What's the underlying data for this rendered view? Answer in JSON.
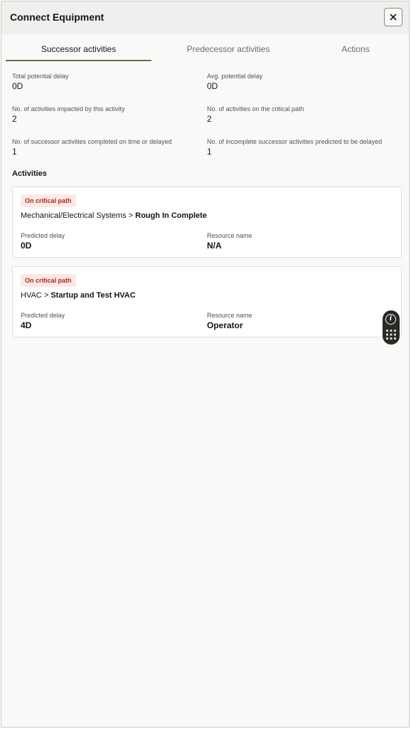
{
  "dialog": {
    "title": "Connect Equipment",
    "close_icon": "close-icon"
  },
  "tabs": [
    {
      "label": "Successor activities",
      "active": true
    },
    {
      "label": "Predecessor activities",
      "active": false
    },
    {
      "label": "Actions",
      "active": false
    }
  ],
  "metrics": {
    "total_potential_delay": {
      "label": "Total potential delay",
      "value": "0D"
    },
    "avg_potential_delay": {
      "label": "Avg. potential delay",
      "value": "0D"
    },
    "activities_impacted": {
      "label": "No. of activities impacted by this activity",
      "value": "2"
    },
    "activities_critical_path": {
      "label": "No. of activities on the critical path",
      "value": "2"
    },
    "successors_completed": {
      "label": "No. of successor activities completed on time or delayed",
      "value": "1"
    },
    "incomplete_predicted_delayed": {
      "label": "No. of incomplete successor activities predicted to be delayed",
      "value": "1"
    }
  },
  "activities_section": {
    "title": "Activities",
    "items": [
      {
        "badge": "On critical path",
        "group": "Mechanical/Electrical Systems",
        "separator": ">",
        "name": "Rough In Complete",
        "predicted_delay_label": "Predicted delay",
        "predicted_delay": "0D",
        "resource_label": "Resource name",
        "resource": "N/A"
      },
      {
        "badge": "On critical path",
        "group": "HVAC",
        "separator": ">",
        "name": "Startup and Test HVAC",
        "predicted_delay_label": "Predicted delay",
        "predicted_delay": "4D",
        "resource_label": "Resource name",
        "resource": "Operator"
      }
    ]
  },
  "floating_toolbar": {
    "info_glyph": "i",
    "icons": [
      "info-icon",
      "keypad-icon"
    ]
  },
  "colors": {
    "accent_tab_underline": "#5c7445",
    "badge_text": "#b3261e",
    "badge_background": "#fce9e6",
    "header_background": "#f1efed"
  }
}
